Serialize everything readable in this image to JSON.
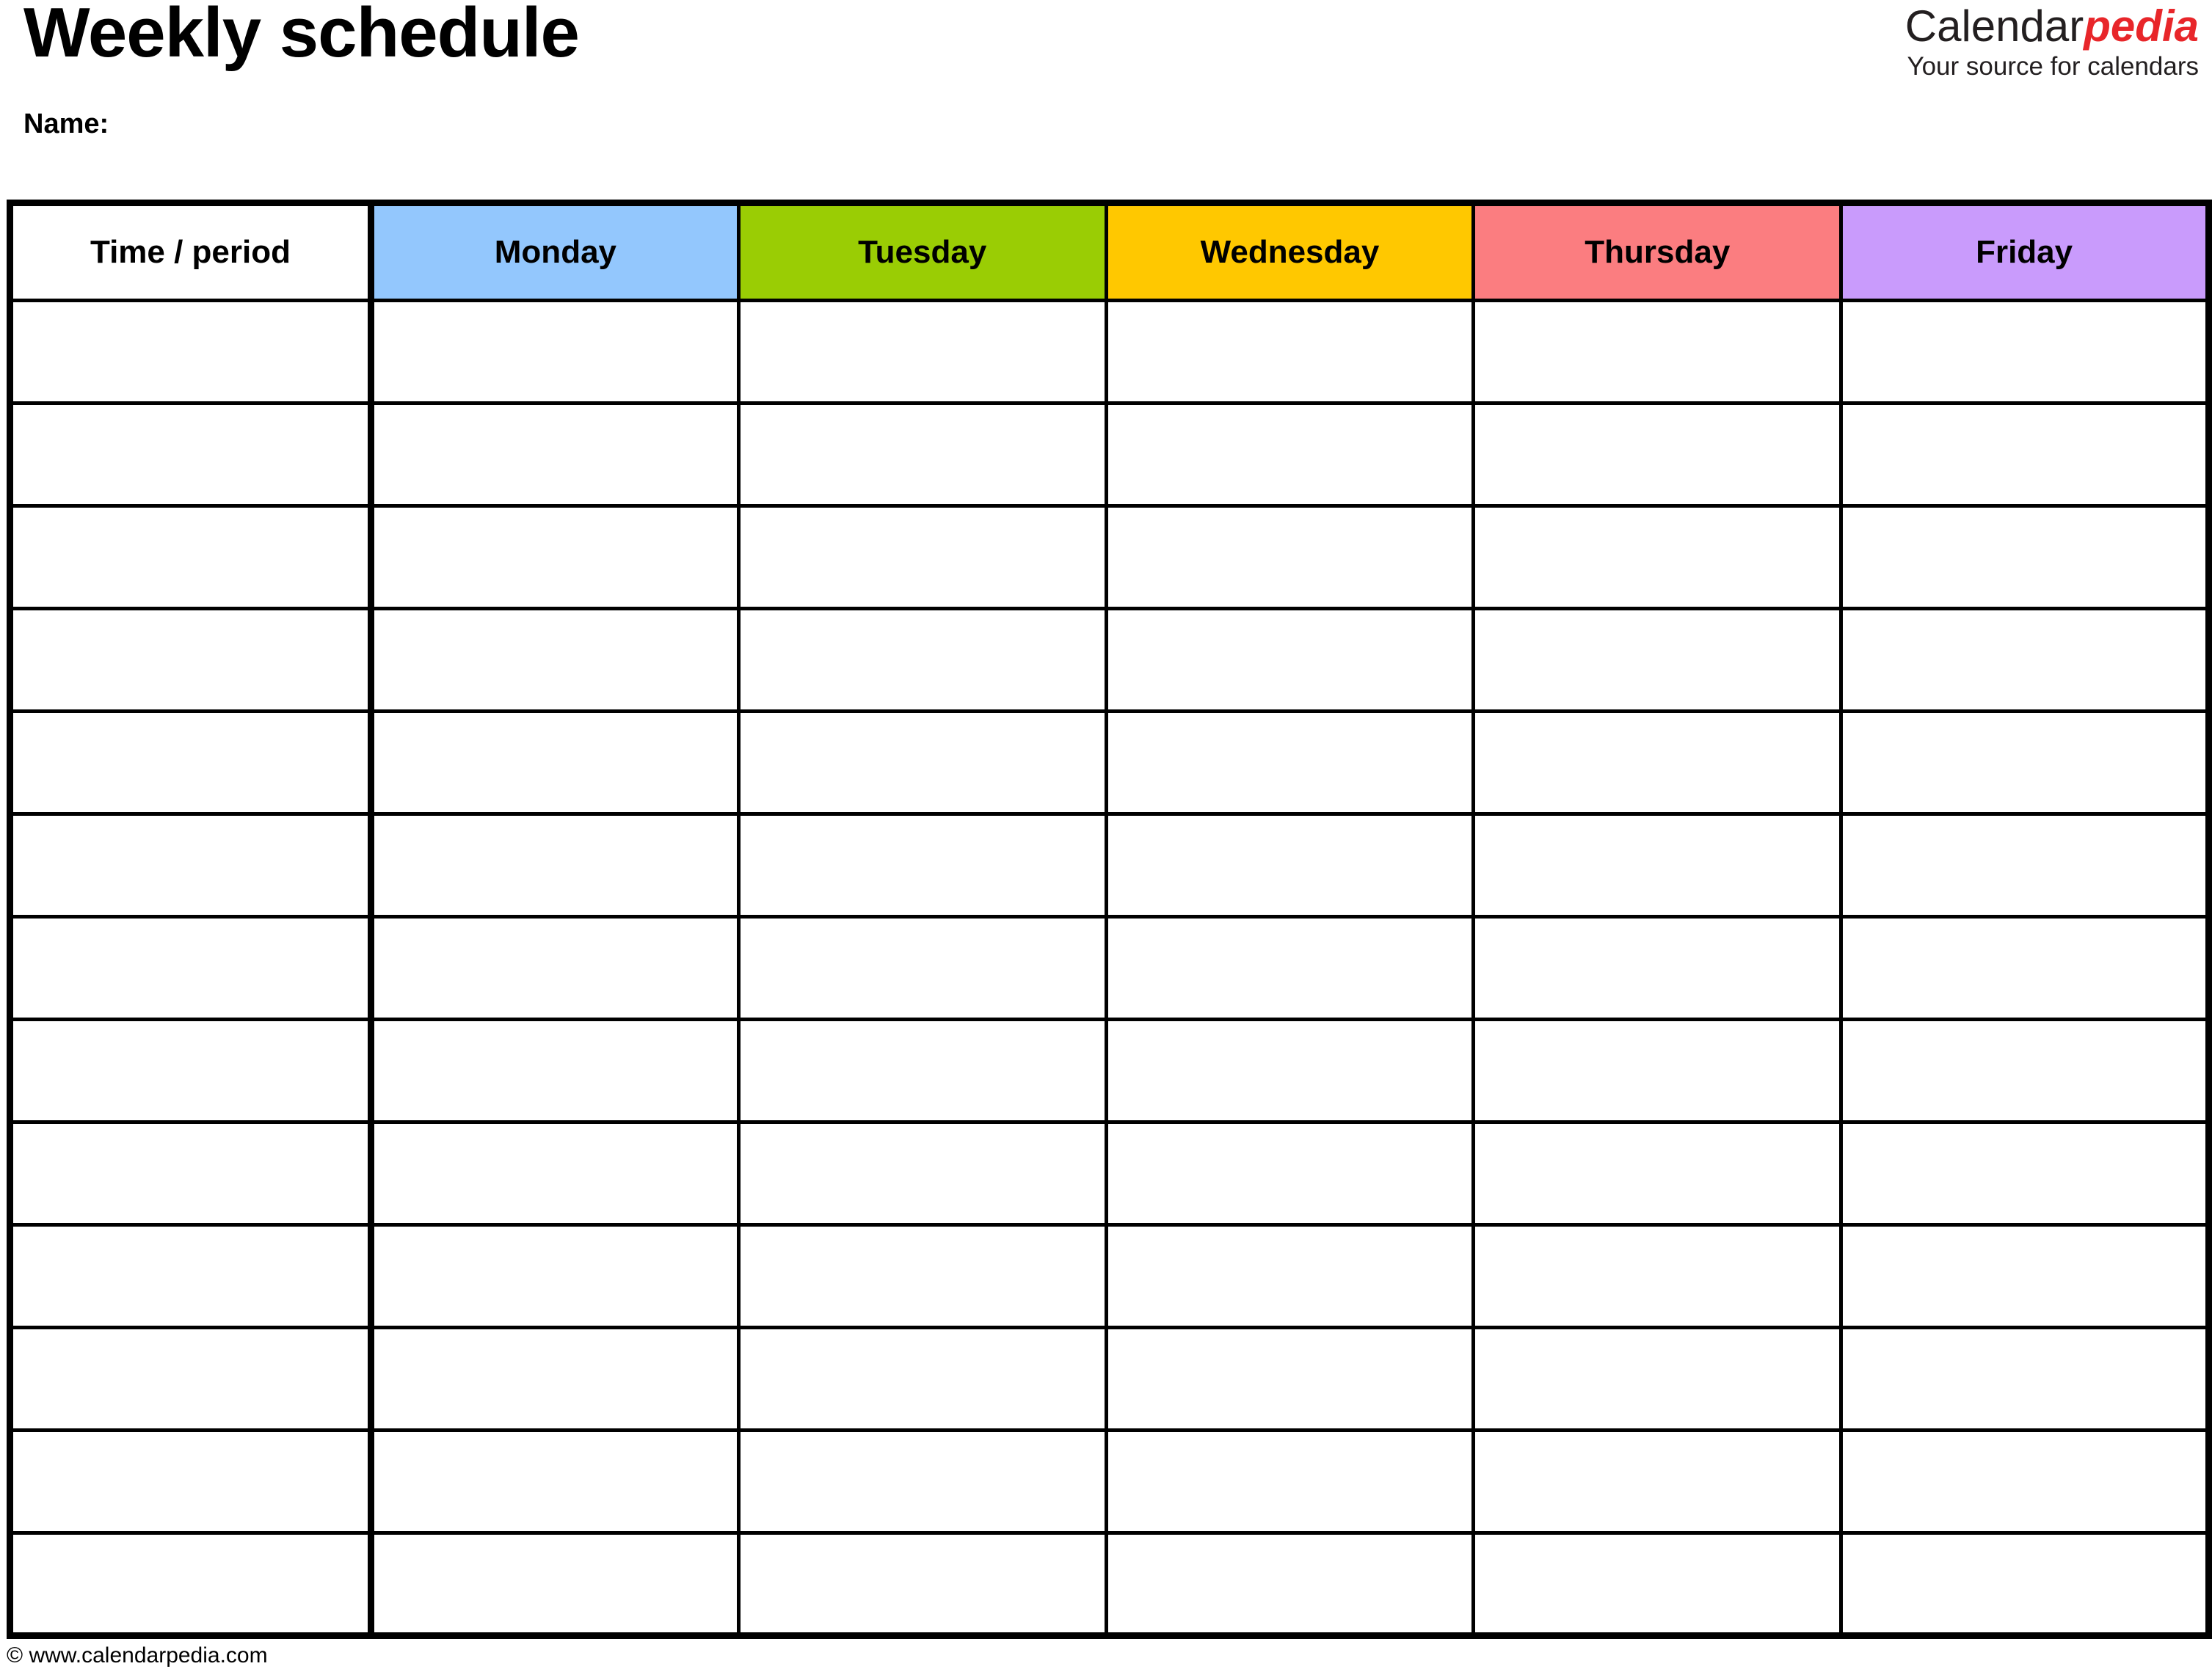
{
  "document": {
    "title": "Weekly schedule",
    "name_label": "Name:"
  },
  "brand": {
    "word_1": "Calendar",
    "word_2": "pedia",
    "tagline": "Your source for calendars",
    "accent_color": "#e8262a"
  },
  "table": {
    "columns": [
      {
        "label": "Time / period",
        "color": "#ffffff"
      },
      {
        "label": "Monday",
        "color": "#93c7fd"
      },
      {
        "label": "Tuesday",
        "color": "#9acd04"
      },
      {
        "label": "Wednesday",
        "color": "#ffc800"
      },
      {
        "label": "Thursday",
        "color": "#fb7d80"
      },
      {
        "label": "Friday",
        "color": "#c99bfc"
      }
    ],
    "body_row_count": 13,
    "rows": [
      {
        "time": "",
        "cells": [
          "",
          "",
          "",
          "",
          ""
        ]
      },
      {
        "time": "",
        "cells": [
          "",
          "",
          "",
          "",
          ""
        ]
      },
      {
        "time": "",
        "cells": [
          "",
          "",
          "",
          "",
          ""
        ]
      },
      {
        "time": "",
        "cells": [
          "",
          "",
          "",
          "",
          ""
        ]
      },
      {
        "time": "",
        "cells": [
          "",
          "",
          "",
          "",
          ""
        ]
      },
      {
        "time": "",
        "cells": [
          "",
          "",
          "",
          "",
          ""
        ]
      },
      {
        "time": "",
        "cells": [
          "",
          "",
          "",
          "",
          ""
        ]
      },
      {
        "time": "",
        "cells": [
          "",
          "",
          "",
          "",
          ""
        ]
      },
      {
        "time": "",
        "cells": [
          "",
          "",
          "",
          "",
          ""
        ]
      },
      {
        "time": "",
        "cells": [
          "",
          "",
          "",
          "",
          ""
        ]
      },
      {
        "time": "",
        "cells": [
          "",
          "",
          "",
          "",
          ""
        ]
      },
      {
        "time": "",
        "cells": [
          "",
          "",
          "",
          "",
          ""
        ]
      },
      {
        "time": "",
        "cells": [
          "",
          "",
          "",
          "",
          ""
        ]
      }
    ]
  },
  "footer": {
    "copyright": "© www.calendarpedia.com"
  }
}
